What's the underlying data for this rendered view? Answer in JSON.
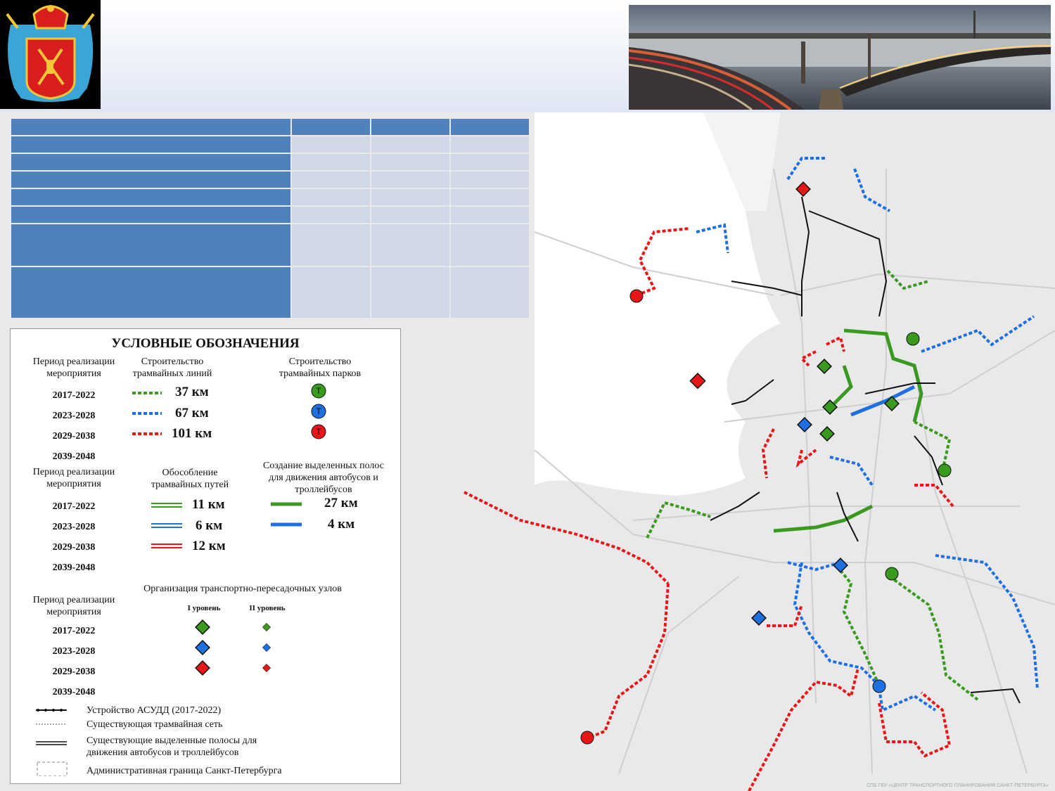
{
  "legend": {
    "title": "УСЛОВНЫЕ ОБОЗНАЧЕНИЯ",
    "period_label": "Период реализации мероприятия",
    "periods": [
      "2017-2022",
      "2023-2028",
      "2029-2038",
      "2039-2048"
    ],
    "tram_lines": {
      "label": "Строительство трамвайных линий",
      "values": [
        "37 км",
        "67 км",
        "101 км"
      ]
    },
    "tram_depots": {
      "label": "Строительство трамвайных парков",
      "icon": "tram-depot-icon"
    },
    "tram_isolation": {
      "label": "Обособление трамвайных путей",
      "values": [
        "11 км",
        "6 км",
        "12 км"
      ]
    },
    "bus_lanes": {
      "label": "Создание выделенных полос для движения автобусов и троллейбусов",
      "values": [
        "27 км",
        "4 км"
      ]
    },
    "hubs": {
      "label": "Организация транспортно-пересадочных узлов",
      "level1": "I уровень",
      "level2": "II уровень"
    },
    "misc": {
      "asudd": "Устройство АСУДД (2017-2022)",
      "existing_tram": "Существующая трамвайная сеть",
      "existing_lanes": "Существующие выделенные полосы для движения автобусов и троллейбусов",
      "border": "Административная граница Санкт-Петербурга"
    },
    "period_colors": [
      "#3a9a1f",
      "#1e6fe0",
      "#e81717"
    ]
  },
  "map": {
    "tram_depot_letter": "Т"
  },
  "credit": "СПБ ГБУ «ЦЕНТР ТРАНСПОРТНОГО ПЛАНИРОВАНИЯ САНКТ-ПЕТЕРБУРГА»"
}
